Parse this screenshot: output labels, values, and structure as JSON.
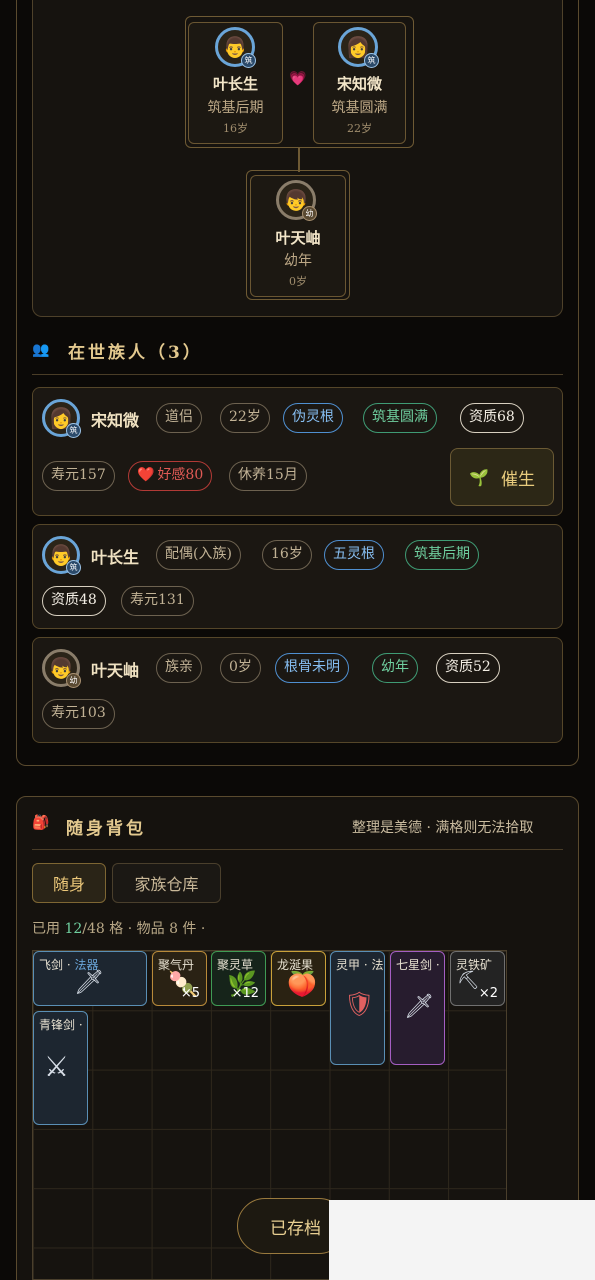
{
  "family_tree": {
    "parent1": {
      "name": "叶长生",
      "stage": "筑基后期",
      "age": "16岁",
      "badge": "筑",
      "avatar": "👨"
    },
    "parent2": {
      "name": "宋知微",
      "stage": "筑基圆满",
      "age": "22岁",
      "badge": "筑",
      "avatar": "👩"
    },
    "heart_icon": "💗",
    "child": {
      "name": "叶天岫",
      "stage": "幼年",
      "age": "0岁",
      "badge": "幼",
      "avatar": "👦"
    }
  },
  "members_section": {
    "icon": "👥",
    "title": "在世族人（3）",
    "members": [
      {
        "name": "宋知微",
        "avatar": "👩",
        "badge": "筑",
        "tags": [
          "道侣",
          "22岁",
          "伪灵根",
          "筑基圆满",
          "资质68"
        ],
        "tags2": [
          "寿元157",
          "好感80",
          "休养15月"
        ],
        "heart_icon": "❤️",
        "action_label": "催生",
        "action_icon": "🌱"
      },
      {
        "name": "叶长生",
        "avatar": "👨",
        "badge": "筑",
        "tags": [
          "配偶(入族)",
          "16岁",
          "五灵根",
          "筑基后期"
        ],
        "tags2": [
          "资质48",
          "寿元131"
        ]
      },
      {
        "name": "叶天岫",
        "avatar": "👦",
        "badge": "幼",
        "tags": [
          "族亲",
          "0岁",
          "根骨未明",
          "幼年",
          "资质52"
        ],
        "tags2": [
          "寿元103"
        ]
      }
    ]
  },
  "backpack": {
    "icon": "🎒",
    "title": "随身背包",
    "hint": "整理是美德 · 满格则无法拾取",
    "tabs": [
      "随身",
      "家族仓库"
    ],
    "usage_prefix": "已用",
    "usage_used": "12",
    "usage_rest": "/48 格 · 物品 8 件 ·",
    "items": [
      {
        "name": "飞剑 · ",
        "name_extra": "法器",
        "icon": "🗡",
        "count": ""
      },
      {
        "name": "聚气丹",
        "icon": "🍡",
        "count": "×5"
      },
      {
        "name": "聚灵草",
        "icon": "🌿",
        "count": "×12"
      },
      {
        "name": "龙涎果",
        "icon": "🍑",
        "count": ""
      },
      {
        "name": "灵甲 · 法",
        "icon": "🛡",
        "count": ""
      },
      {
        "name": "七星剑 ·",
        "icon": "🗡",
        "count": ""
      },
      {
        "name": "灵铁矿",
        "icon": "⛏",
        "count": "×2"
      },
      {
        "name": "青锋剑 ·",
        "icon": "⚔",
        "count": ""
      }
    ],
    "saved_label": "已存档"
  },
  "colors": {
    "accent": "#e3c98f",
    "blue_tag": "#4f8fd0",
    "green_tag": "#3f9b74",
    "red_tag": "#b23a36"
  }
}
